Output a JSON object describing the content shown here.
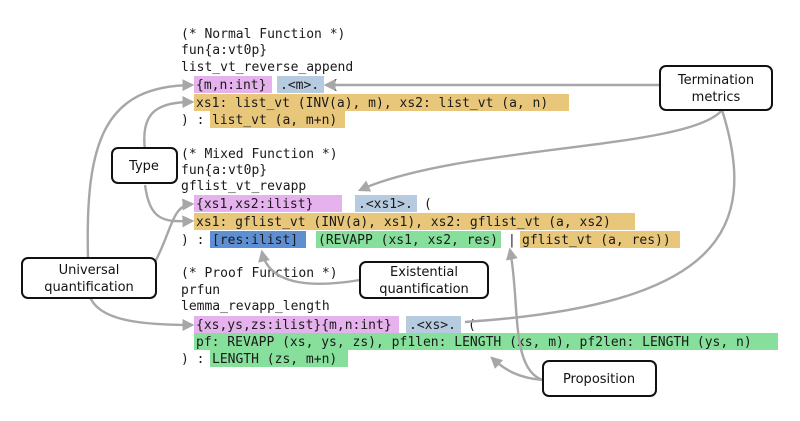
{
  "colors": {
    "universal": "#e6b2ee",
    "metric": "#b7cbe0",
    "type": "#e8c77b",
    "proposition": "#86e09b",
    "existential": "#5e8fd3",
    "arrow": "#a7a7a7"
  },
  "code": {
    "normal_comment": "(* Normal Function *)",
    "normal_fun": "fun{a:vt0p}",
    "normal_name": "list_vt_reverse_append",
    "normal_univ": "{m,n:int}",
    "normal_metric": ".<m>.",
    "paren_open": "(",
    "normal_args": "xs1: list_vt (INV(a), m), xs2: list_vt (a, n)",
    "ret_prefix": ") :",
    "normal_ret": "list_vt (a, m+n)",
    "mixed_comment": "(* Mixed Function *)",
    "mixed_fun": "fun{a:vt0p}",
    "mixed_name": "gflist_vt_revapp",
    "mixed_univ": "{xs1,xs2:ilist}",
    "mixed_metric": ".<xs1>.",
    "mixed_args": "xs1: gflist_vt (INV(a), xs1), xs2: gflist_vt (a, xs2)",
    "mixed_exist": "[res:ilist]",
    "mixed_prop": "(REVAPP (xs1, xs2, res)",
    "mixed_bar": "|",
    "mixed_ret": "gflist_vt (a, res))",
    "proof_comment": "(* Proof Function *)",
    "proof_fun": "prfun",
    "proof_name": "lemma_revapp_length",
    "proof_univ": "{xs,ys,zs:ilist}{m,n:int}",
    "proof_metric": ".<xs>.",
    "proof_args": "pf: REVAPP (xs, ys, zs), pf1len: LENGTH (xs, m), pf2len: LENGTH (ys, n)",
    "proof_ret": "LENGTH (zs, m+n)"
  },
  "labels": {
    "termination": [
      "Termination",
      "metrics"
    ],
    "type": "Type",
    "universal": [
      "Universal",
      "quantification"
    ],
    "existential": [
      "Existential",
      "quantification"
    ],
    "proposition": "Proposition"
  }
}
